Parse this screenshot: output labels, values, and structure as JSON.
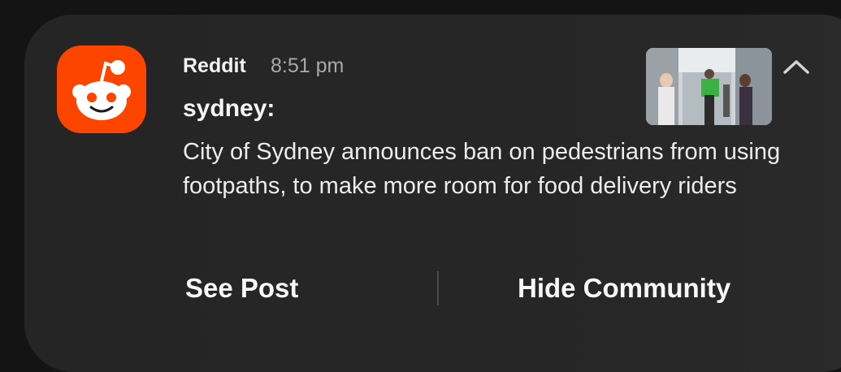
{
  "notification": {
    "app_name": "Reddit",
    "timestamp": "8:51 pm",
    "title": "sydney:",
    "body": "City of Sydney announces ban on pedestrians from using footpaths, to make more room for food delivery riders",
    "app_icon": "reddit-snoo-icon",
    "collapse_icon": "chevron-up-icon",
    "accent_color": "#fd4500"
  },
  "actions": {
    "see_post": "See Post",
    "hide_community": "Hide Community"
  }
}
